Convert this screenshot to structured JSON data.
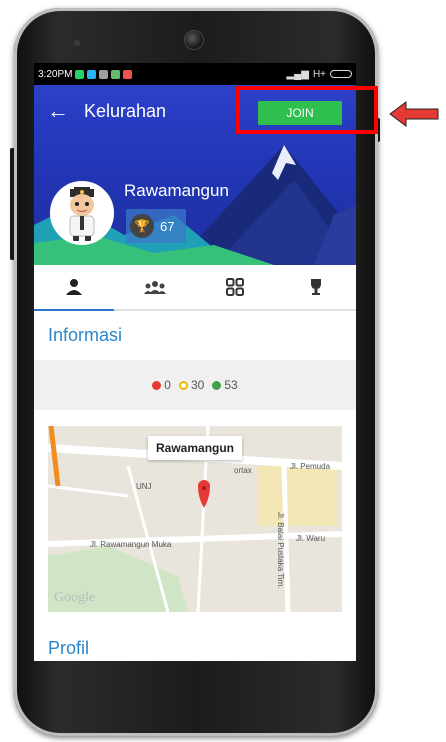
{
  "status_bar": {
    "time": "3:20PM",
    "network": "H+"
  },
  "toolbar": {
    "title": "Kelurahan",
    "join_label": "JOIN"
  },
  "profile": {
    "name": "Rawamangun",
    "score": "67"
  },
  "tabs": [
    "profile",
    "members",
    "grid",
    "trophy"
  ],
  "informasi": {
    "title": "Informasi"
  },
  "stats": {
    "red": "0",
    "yellow": "30",
    "green": "53"
  },
  "map": {
    "pin_label": "Rawamangun",
    "streets": [
      "Jl. Pemuda",
      "UNJ",
      "Jl. Rawamangun Muka",
      "Jl. Balai Pustaka Tim.",
      "Jl. Waru",
      "ortax"
    ],
    "watermark": "Google"
  },
  "profil": {
    "title": "Profil"
  },
  "colors": {
    "accent": "#2a86c9",
    "header": "#2236b7",
    "join": "#2fbf4e",
    "annotation": "#ff0000"
  }
}
